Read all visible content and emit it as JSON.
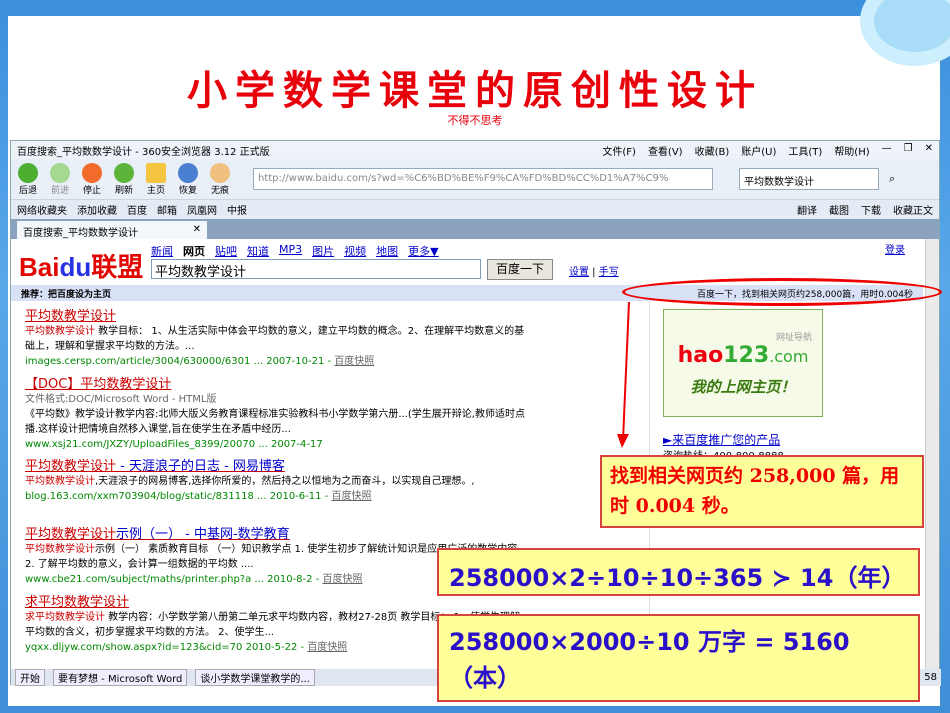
{
  "slide": {
    "title": "小学数学课堂的原创性设计",
    "subtitle": "不得不思考"
  },
  "browser": {
    "window_title": "百度搜索_平均数数学设计 - 360安全浏览器 3.12 正式版",
    "menus": [
      "文件(F)",
      "查看(V)",
      "收藏(B)",
      "账户(U)",
      "工具(T)",
      "帮助(H)"
    ],
    "toolbar": [
      "后退",
      "前进",
      "停止",
      "刷新",
      "主页",
      "恢复",
      "无痕"
    ],
    "url": "http://www.baidu.com/s?wd=%C6%BD%BE%F9%CA%FD%BD%CC%D1%A7%C9%",
    "search_box": "平均数数学设计",
    "favorites": [
      "网络收藏夹",
      "添加收藏",
      "百度",
      "邮箱",
      "凤凰网",
      "中报"
    ],
    "fav_right": [
      "翻译",
      "截图",
      "下载",
      "收藏正文"
    ],
    "tab": "百度搜索_平均数数学设计"
  },
  "baidu": {
    "logo": "Bai",
    "logo_du": "du",
    "logo_suffix": "联盟",
    "nav": [
      "新闻",
      "网页",
      "贴吧",
      "知道",
      "MP3",
      "图片",
      "视频",
      "地图",
      "更多▼"
    ],
    "query": "平均数教学设计",
    "button": "百度一下",
    "settings": "设置",
    "handwrite": "手写",
    "login": "登录",
    "recommend": "推荐：把百度设为主页",
    "stats": "百度一下，找到相关网页约258,000篇，用时0.004秒",
    "results": [
      {
        "title": "平均数教学设计",
        "title_rest": "",
        "snippet_hl": "平均数教学设计",
        "snippet": " 教学目标： 1、从生活实际中体会平均数的意义，建立平均数的概念。2、在理解平均数意义的基础上，理解和掌握求平均数的方法。...",
        "url": "images.cersp.com/article/3004/630000/6301 ... 2007-10-21 - ",
        "cache": "百度快照"
      },
      {
        "title": "【DOC】平均数教学设计",
        "title_rest": "",
        "snippet_hl": "文件格式:DOC/Microsoft Word - HTML版",
        "snippet": " 《平均数》教学设计教学内容:北师大版义务教育课程标准实验教科书小学数学第六册...(学生展开辩论,教师适时点播.这样设计把情境自然移入课堂,旨在使学生在矛盾中经历...",
        "url": "www.xsj21.com/JXZY/UploadFiles_8399/20070 ... 2007-4-17",
        "cache": ""
      },
      {
        "title": "平均数教学设计",
        "title_rest": " - 天涯浪子的日志 - 网易博客",
        "snippet_hl": "平均数教学设计",
        "snippet": ",天涯浪子的网易博客,选择你所爱的，然后持之以恒地为之而奋斗，以实现自己理想。,",
        "url": "blog.163.com/xxm703904/blog/static/831118 ... 2010-6-11 - ",
        "cache": "百度快照"
      },
      {
        "title": "平均数教学设计",
        "title_rest": "示例（一） - 中基网-数学教育",
        "snippet_hl": "平均数教学设计",
        "snippet": "示例（一） 素质教育目标 （一）知识教学点 1. 使学生初步了解统计知识是应用广泛的数学内容 . 2. 了解平均数的意义，会计算一组数据的平均数 ....",
        "url": "www.cbe21.com/subject/maths/printer.php?a ... 2010-8-2 - ",
        "cache": "百度快照"
      },
      {
        "title": "求平均数教学设计",
        "title_rest": "",
        "snippet_hl": "求平均数教学设计",
        "snippet": " 教学内容：小学数学第八册第二单元求平均数内容，教材27-28页 教学目标： 1、使学生理解平均数的含义，初步掌握求平均数的方法。 2、使学生...",
        "url": "yqxx.dljyw.com/show.aspx?id=123&cid=70 2010-5-22 - ",
        "cache": "百度快照"
      }
    ],
    "ad_brand": "hao",
    "ad_brand_num": "123",
    "ad_brand_suffix": ".com",
    "ad_nav": "网址导航",
    "ad_slogan": "我的上网主页！",
    "promo": "►来百度推广您的产品",
    "hotline": "咨询热线：400-800-8888"
  },
  "taskbar": {
    "start": "开始",
    "items": [
      "要有梦想 - Microsoft Word",
      "谈小学数学课堂教学的..."
    ],
    "clock": "58"
  },
  "callouts": {
    "found": "找到相关网页约 258,000 篇，用时 0.004 秒。",
    "calc1": "258000×2÷10÷10÷365 ≻ 14（年）",
    "calc2": "258000×2000÷10 万字  = 5160（本）"
  }
}
